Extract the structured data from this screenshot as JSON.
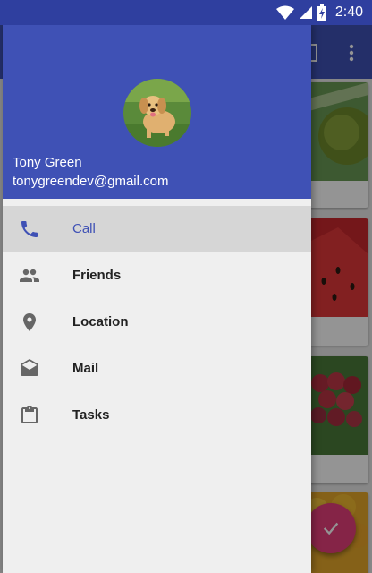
{
  "status_bar": {
    "time": "2:40"
  },
  "drawer": {
    "header": {
      "user_name": "Tony Green",
      "user_email": "tonygreendev@gmail.com"
    },
    "items": [
      {
        "label": "Call",
        "icon": "phone-icon",
        "checked": true
      },
      {
        "label": "Friends",
        "icon": "people-icon",
        "checked": false
      },
      {
        "label": "Location",
        "icon": "location-pin-icon",
        "checked": false
      },
      {
        "label": "Mail",
        "icon": "mail-icon",
        "checked": false
      },
      {
        "label": "Tasks",
        "icon": "clipboard-icon",
        "checked": false
      }
    ]
  },
  "colors": {
    "primary": "#3f51b5",
    "primary_dark": "#2f3f9f",
    "accent": "#e53f7a",
    "checked_item_bg": "#d6d6d6",
    "drawer_bg": "#efefef"
  }
}
